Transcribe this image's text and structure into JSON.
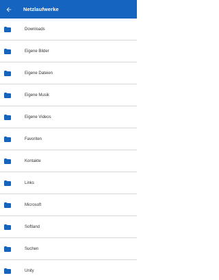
{
  "header": {
    "title": "Netzlaufwerke",
    "back_icon": "arrow-back-icon",
    "background_color": "#1565c0",
    "text_color": "#ffffff"
  },
  "folders": {
    "icon": "folder-icon",
    "icon_color": "#1565c0",
    "items": [
      {
        "label": "Downloads"
      },
      {
        "label": "Eigene Bilder"
      },
      {
        "label": "Eigene Dateien"
      },
      {
        "label": "Eigene Musik"
      },
      {
        "label": "Eigene Videos"
      },
      {
        "label": "Favoriten"
      },
      {
        "label": "Kontakte"
      },
      {
        "label": "Links"
      },
      {
        "label": "Microsoft"
      },
      {
        "label": "Softland"
      },
      {
        "label": "Suchen"
      },
      {
        "label": "Unity"
      }
    ]
  }
}
